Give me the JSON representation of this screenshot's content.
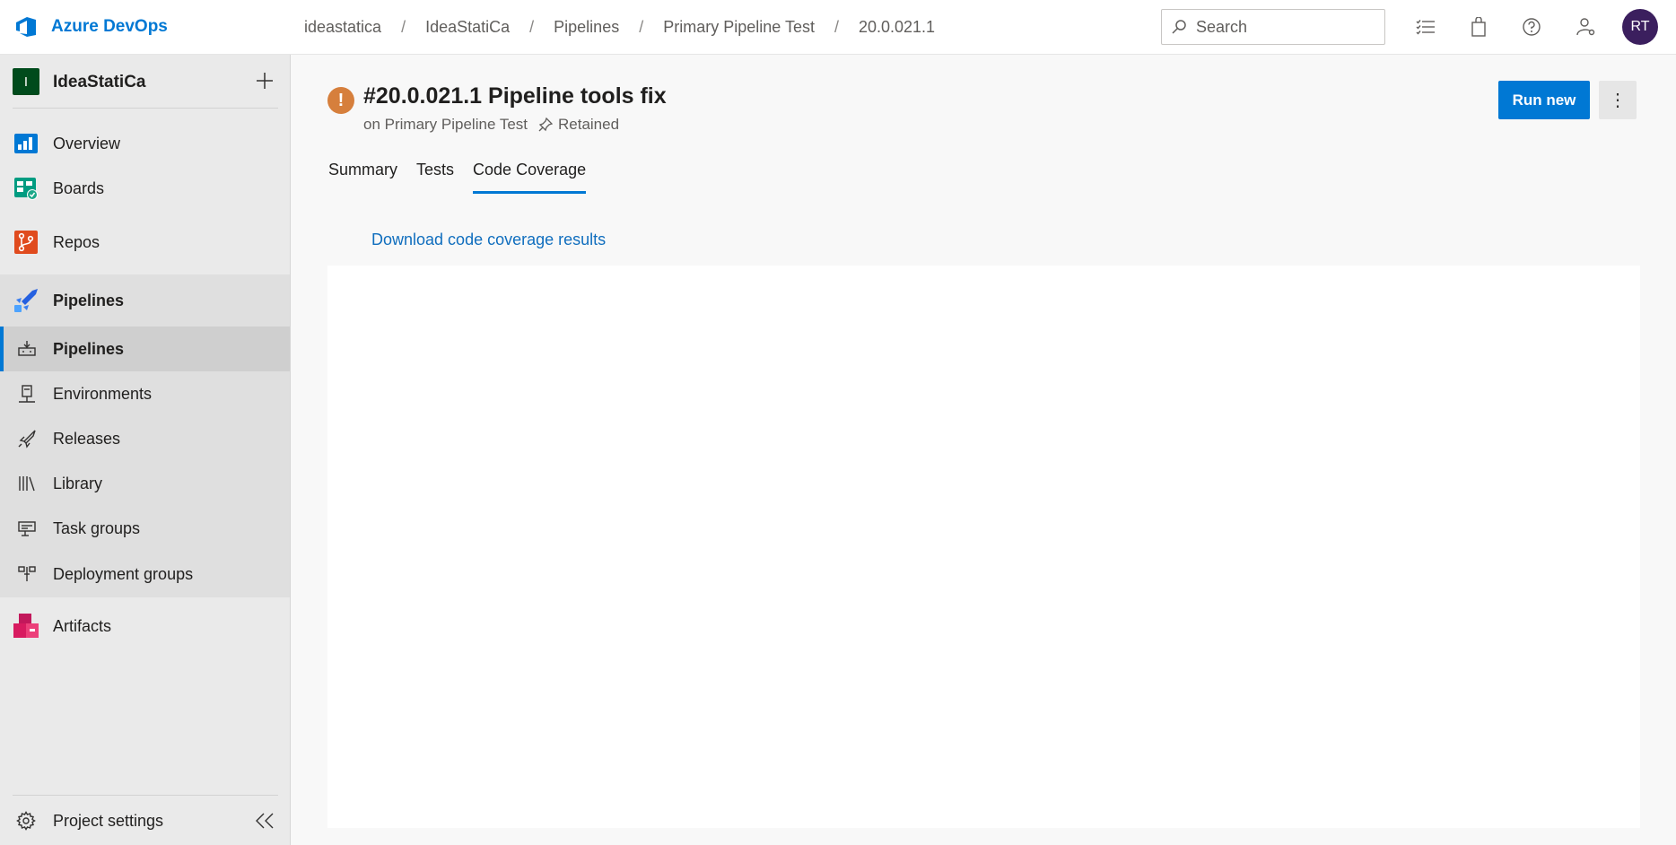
{
  "header": {
    "brand": "Azure DevOps",
    "breadcrumb": [
      "ideastatica",
      "IdeaStatiCa",
      "Pipelines",
      "Primary Pipeline Test",
      "20.0.021.1"
    ],
    "search_placeholder": "Search",
    "avatar_initials": "RT",
    "icons": [
      "work-items-icon",
      "marketplace-bag-icon",
      "help-icon",
      "user-settings-icon"
    ]
  },
  "sidebar": {
    "project_initial": "I",
    "project_name": "IdeaStatiCa",
    "items": [
      {
        "label": "Overview",
        "icon": "overview-icon"
      },
      {
        "label": "Boards",
        "icon": "boards-icon"
      },
      {
        "label": "Repos",
        "icon": "repos-icon"
      },
      {
        "label": "Pipelines",
        "icon": "pipelines-icon"
      },
      {
        "label": "Artifacts",
        "icon": "artifacts-icon"
      }
    ],
    "pipeline_subitems": [
      {
        "label": "Pipelines",
        "icon": "pipeline-icon"
      },
      {
        "label": "Environments",
        "icon": "environment-icon"
      },
      {
        "label": "Releases",
        "icon": "rocket-icon"
      },
      {
        "label": "Library",
        "icon": "library-icon"
      },
      {
        "label": "Task groups",
        "icon": "task-group-icon"
      },
      {
        "label": "Deployment groups",
        "icon": "deployment-group-icon"
      }
    ],
    "project_settings": "Project settings"
  },
  "run": {
    "title": "#20.0.021.1 Pipeline tools fix",
    "on_pipeline": "on Primary Pipeline Test",
    "retained": "Retained",
    "status_glyph": "!",
    "run_new_label": "Run new",
    "more_glyph": "⋮"
  },
  "tabs": [
    {
      "label": "Summary",
      "active": false
    },
    {
      "label": "Tests",
      "active": false
    },
    {
      "label": "Code Coverage",
      "active": true
    }
  ],
  "coverage": {
    "download_link": "Download code coverage results"
  },
  "colors": {
    "accent": "#0078d4",
    "warning": "#d67f3c",
    "avatar": "#3b1f5e",
    "project_badge": "#004b1c"
  }
}
